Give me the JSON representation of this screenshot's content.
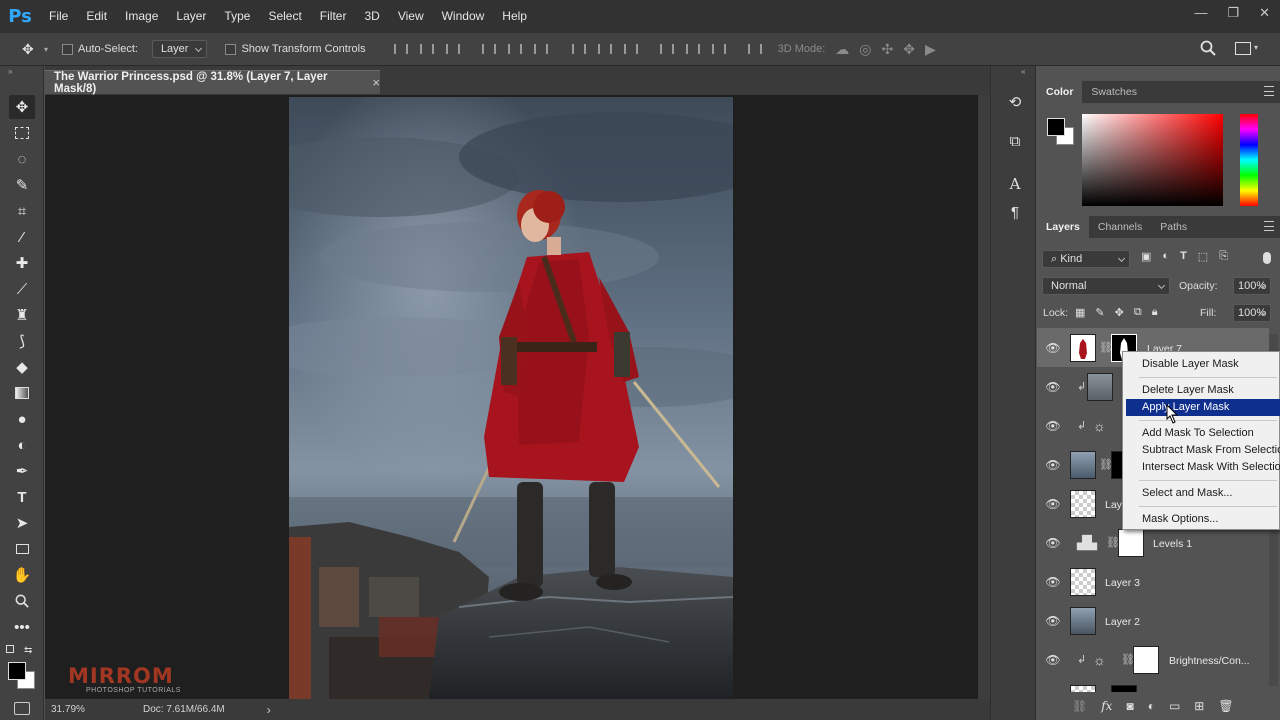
{
  "app": {
    "logo": "Ps"
  },
  "menu": [
    "File",
    "Edit",
    "Image",
    "Layer",
    "Type",
    "Select",
    "Filter",
    "3D",
    "View",
    "Window",
    "Help"
  ],
  "window_controls": {
    "minimize": "—",
    "restore": "❐",
    "close": "✕"
  },
  "options_bar": {
    "auto_select_label": "Auto-Select:",
    "auto_select_value": "Layer",
    "show_transform_label": "Show Transform Controls",
    "mode_3d_label": "3D Mode:"
  },
  "document": {
    "tab_title": "The Warrior Princess.psd @ 31.8% (Layer 7, Layer Mask/8)",
    "tab_close": "×"
  },
  "status": {
    "zoom": "31.79%",
    "doc": "Doc: 7.61M/66.4M",
    "arrow": "›"
  },
  "watermark": {
    "brand": "MIRROM",
    "tagline": "PHOTOSHOP TUTORIALS"
  },
  "color_panel": {
    "tabs": [
      "Color",
      "Swatches"
    ]
  },
  "layers_panel": {
    "tabs": [
      "Layers",
      "Channels",
      "Paths"
    ],
    "filter_kind": "Kind",
    "blend_mode": "Normal",
    "opacity_label": "Opacity:",
    "opacity_value": "100%",
    "lock_label": "Lock:",
    "fill_label": "Fill:",
    "fill_value": "100%",
    "layers": [
      {
        "name": "Layer 7"
      },
      {
        "name": ""
      },
      {
        "name": ""
      },
      {
        "name": ""
      },
      {
        "name": "Lay"
      },
      {
        "name": "Levels 1"
      },
      {
        "name": "Layer 3"
      },
      {
        "name": "Layer 2"
      },
      {
        "name": "Brightness/Con..."
      }
    ]
  },
  "context_menu": {
    "items": [
      "Disable Layer Mask",
      "Delete Layer Mask",
      "Apply Layer Mask",
      "Add Mask To Selection",
      "Subtract Mask From Selection",
      "Intersect Mask With Selection",
      "Select and Mask...",
      "Mask Options..."
    ],
    "highlighted": "Apply Layer Mask"
  },
  "colors": {
    "accent": "#31a8ff",
    "highlight": "#0f2f8f",
    "cloak": "#a8141e"
  }
}
